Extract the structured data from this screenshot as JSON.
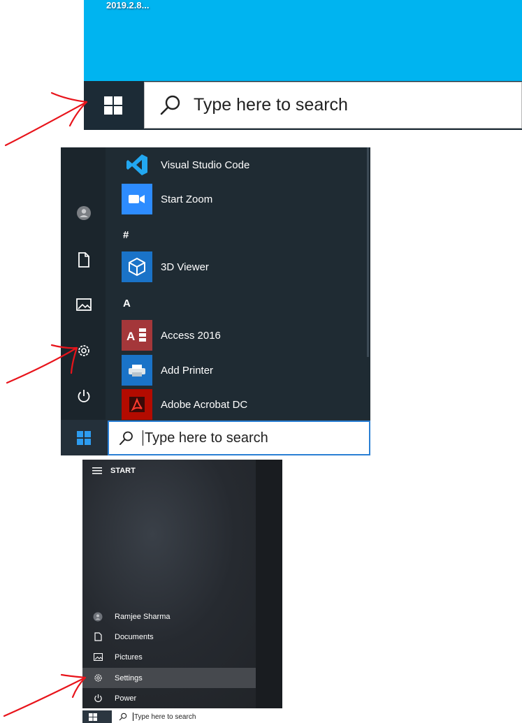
{
  "panel1": {
    "desktop_file_label": "2019.2.8...",
    "search_placeholder": "Type here to search",
    "start_icon": "windows-logo-icon",
    "search_icon": "search-icon"
  },
  "panel2": {
    "rail": [
      {
        "name": "user-avatar",
        "icon": "avatar-icon"
      },
      {
        "name": "documents",
        "icon": "document-icon"
      },
      {
        "name": "pictures",
        "icon": "pictures-icon"
      },
      {
        "name": "settings",
        "icon": "gear-icon"
      },
      {
        "name": "power",
        "icon": "power-icon"
      }
    ],
    "apps": [
      {
        "label": "Visual Studio Code",
        "icon": "vscode-icon"
      },
      {
        "label": "Start Zoom",
        "icon": "zoom-icon"
      },
      {
        "label": "3D Viewer",
        "icon": "cube-icon"
      },
      {
        "label": "Access 2016",
        "icon": "access-icon"
      },
      {
        "label": "Add Printer",
        "icon": "printer-icon"
      },
      {
        "label": "Adobe Acrobat DC",
        "icon": "acrobat-icon"
      }
    ],
    "section_hash": "#",
    "section_a": "A",
    "search_placeholder": "Type here to search"
  },
  "panel3": {
    "header": "START",
    "items": [
      {
        "label": "Ramjee Sharma",
        "icon": "avatar-icon"
      },
      {
        "label": "Documents",
        "icon": "document-icon"
      },
      {
        "label": "Pictures",
        "icon": "pictures-icon"
      },
      {
        "label": "Settings",
        "icon": "gear-icon",
        "selected": true
      },
      {
        "label": "Power",
        "icon": "power-icon"
      }
    ],
    "search_placeholder": "Type here to search"
  },
  "colors": {
    "desktop": "#00b4f0",
    "taskbar": "#1c2b36",
    "menu": "#1f2b33",
    "vscode_tile": "#1f2b33",
    "zoom_tile": "#2d8cff",
    "viewer_tile": "#1a73c8",
    "access_tile": "#a4373a",
    "printer_tile": "#1a73c8",
    "acrobat_tile": "#b30b00",
    "annotation_arrow": "#e8141b",
    "search_focus_border": "#2a7fd4"
  }
}
